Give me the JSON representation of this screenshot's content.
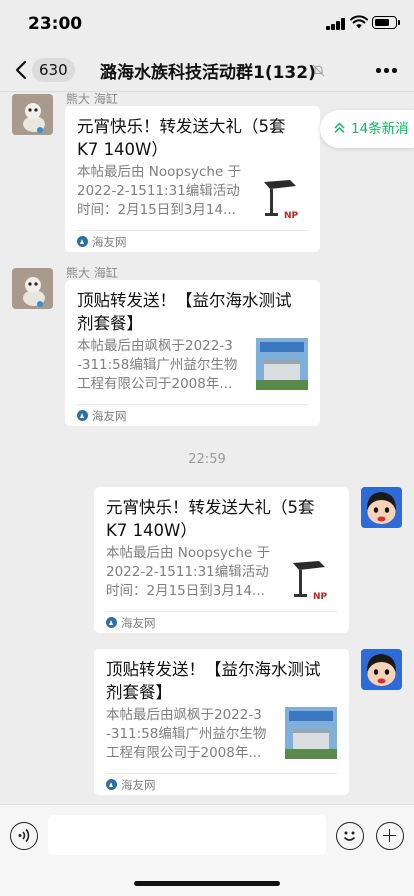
{
  "status_bar": {
    "time": "23:00"
  },
  "header": {
    "back_count": "630",
    "title": "潞海水族科技活动群1(132)",
    "mute_icon": "mute-bell-icon"
  },
  "new_messages": {
    "label": "14条新消"
  },
  "messages": [
    {
      "sender": "熊大 海缸",
      "title": "元宵快乐！转发送大礼（5套K7 140W）",
      "title_lines": [
        "元宵快乐！转发送大礼（5套",
        "K7 140W）"
      ],
      "desc_lines": [
        "本帖最后由 Noopsyche 于",
        "2022-2-1511:31编辑活动",
        "时间：2月15日到3月14..."
      ],
      "source": "海友网",
      "thumb": "light-fixture"
    },
    {
      "sender": "熊大 海缸",
      "title": "顶贴转发送！【益尔海水测试剂套餐】",
      "title_lines": [
        "顶贴转发送！【益尔海水测试",
        "剂套餐】"
      ],
      "desc_lines": [
        "本帖最后由飒枫于2022-3",
        "-311:58编辑广州益尔生物",
        "工程有限公司于2008年..."
      ],
      "source": "海友网",
      "thumb": "building"
    }
  ],
  "timestamp": "22:59",
  "my_messages": [
    {
      "title": "元宵快乐！转发送大礼（5套K7 140W）",
      "title_lines": [
        "元宵快乐！转发送大礼（5套",
        "K7 140W）"
      ],
      "desc_lines": [
        "本帖最后由 Noopsyche 于",
        "2022-2-1511:31编辑活动",
        "时间：2月15日到3月14..."
      ],
      "source": "海友网",
      "thumb": "light-fixture"
    },
    {
      "title": "顶贴转发送！【益尔海水测试剂套餐】",
      "title_lines": [
        "顶贴转发送！【益尔海水测试",
        "剂套餐】"
      ],
      "desc_lines": [
        "本帖最后由飒枫于2022-3",
        "-311:58编辑广州益尔生物",
        "工程有限公司于2008年..."
      ],
      "source": "海友网",
      "thumb": "building"
    }
  ],
  "colors": {
    "accent_green": "#07c160",
    "background": "#ededed",
    "card": "#ffffff"
  }
}
